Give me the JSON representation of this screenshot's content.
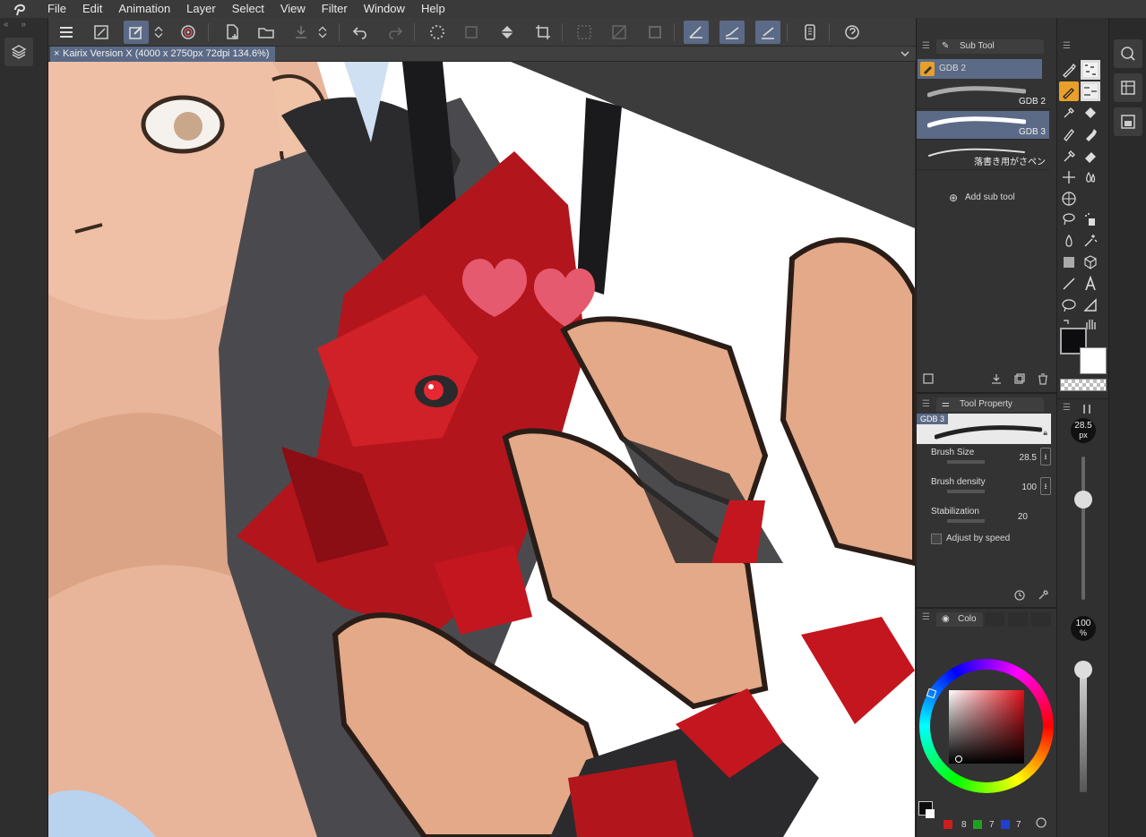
{
  "menu": {
    "items": [
      "File",
      "Edit",
      "Animation",
      "Layer",
      "Select",
      "View",
      "Filter",
      "Window",
      "Help"
    ]
  },
  "canvas_tab": {
    "title": "Kairix Version X (4000 x 2750px 72dpi 134.6%)"
  },
  "subtool": {
    "tab_label": "Sub Tool",
    "group_label": "GDB 2",
    "brushes": [
      "GDB 2",
      "GDB 3",
      "落書き用がさペン"
    ],
    "selected_index": 1,
    "add_label": "Add sub tool"
  },
  "tool_property": {
    "tab_label": "Tool Property",
    "preview_label": "GDB 3",
    "brush_size_label": "Brush Size",
    "brush_size_value": "28.5",
    "brush_density_label": "Brush density",
    "brush_density_value": "100",
    "stabilization_label": "Stabilization",
    "stabilization_value": "20",
    "adjust_speed_label": "Adjust by speed"
  },
  "color_panel": {
    "tab_label": "Colo",
    "counts": [
      "8",
      "7",
      "7"
    ],
    "main_color": "#0d0d0f",
    "sub_color": "#ffffff"
  },
  "brush_size_slider": {
    "value_label": "28.5",
    "unit_label": "px",
    "level": 0.7
  },
  "opacity_slider": {
    "value_label": "100",
    "unit_label": "%",
    "level": 1.0
  },
  "colors": {
    "accent": "#5b6a86",
    "selected_tool": "#e8a02a"
  }
}
